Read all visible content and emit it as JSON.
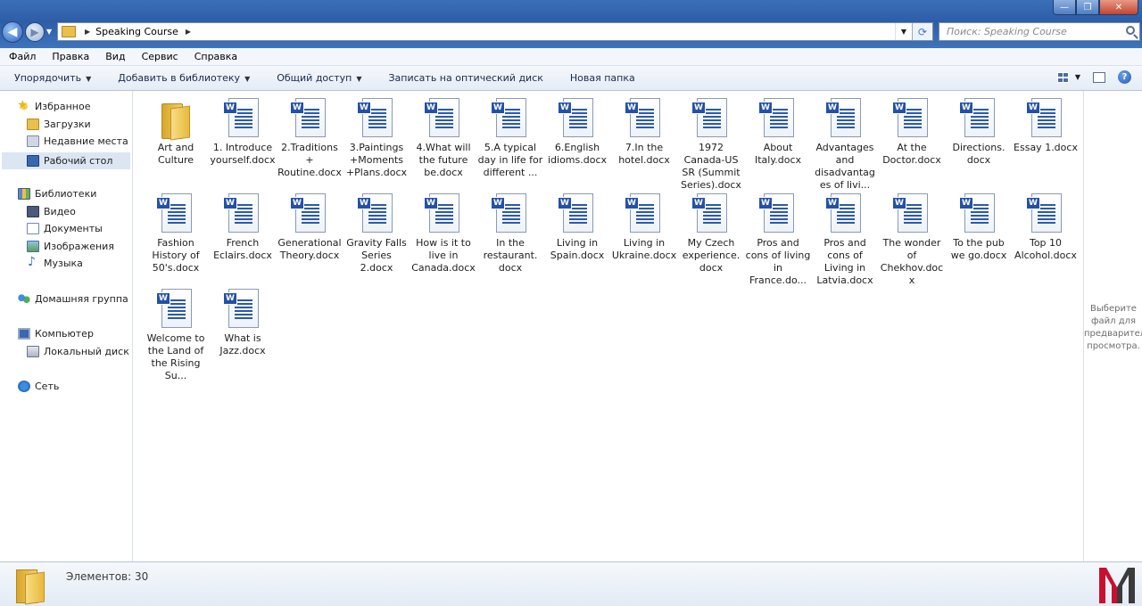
{
  "window": {
    "buttons": {
      "minimize": "—",
      "maximize": "❐",
      "close": "✕"
    }
  },
  "address": {
    "path": "Speaking Course",
    "search_placeholder": "Поиск: Speaking Course"
  },
  "menubar": [
    "Файл",
    "Правка",
    "Вид",
    "Сервис",
    "Справка"
  ],
  "commandbar": {
    "organize": "Упорядочить",
    "add_to_library": "Добавить в библиотеку",
    "share": "Общий доступ",
    "burn": "Записать на оптический диск",
    "new_folder": "Новая папка"
  },
  "navpane": {
    "favorites": "Избранное",
    "downloads": "Загрузки",
    "recent": "Недавние места",
    "desktop": "Рабочий стол",
    "libraries": "Библиотеки",
    "video": "Видео",
    "documents": "Документы",
    "images": "Изображения",
    "music": "Музыка",
    "homegroup": "Домашняя группа",
    "computer": "Компьютер",
    "local_disk": "Локальный диск (C",
    "network": "Сеть"
  },
  "files": [
    {
      "label": "Art and Culture",
      "type": "folder"
    },
    {
      "label": "1. Introduce yourself.docx",
      "type": "docx"
    },
    {
      "label": "2.Traditions + Routine.docx",
      "type": "docx"
    },
    {
      "label": "3.Paintings +Moments +Plans.docx",
      "type": "docx"
    },
    {
      "label": "4.What will the future be.docx",
      "type": "docx"
    },
    {
      "label": "5.A typical day in life for different ...",
      "type": "docx"
    },
    {
      "label": "6.English idioms.docx",
      "type": "docx"
    },
    {
      "label": "7.In the hotel.docx",
      "type": "docx"
    },
    {
      "label": "1972 Canada-US SR (Summit Series).docx",
      "type": "docx"
    },
    {
      "label": "About Italy.docx",
      "type": "docx"
    },
    {
      "label": "Advantages and disadvantages of livi...",
      "type": "docx"
    },
    {
      "label": "At the Doctor.docx",
      "type": "docx"
    },
    {
      "label": "Directions. docx",
      "type": "docx"
    },
    {
      "label": "Essay 1.docx",
      "type": "docx"
    },
    {
      "label": "Fashion History of 50's.docx",
      "type": "docx"
    },
    {
      "label": "French Eclairs.docx",
      "type": "docx"
    },
    {
      "label": "Generational Theory.docx",
      "type": "docx"
    },
    {
      "label": "Gravity Falls Series 2.docx",
      "type": "docx"
    },
    {
      "label": "How is it to live in Canada.docx",
      "type": "docx"
    },
    {
      "label": "In the restaurant. docx",
      "type": "docx"
    },
    {
      "label": "Living in Spain.docx",
      "type": "docx"
    },
    {
      "label": "Living in Ukraine.docx",
      "type": "docx"
    },
    {
      "label": "My Czech experience. docx",
      "type": "docx"
    },
    {
      "label": "Pros and cons of living in France.do...",
      "type": "docx"
    },
    {
      "label": "Pros and cons of Living in Latvia.docx",
      "type": "docx"
    },
    {
      "label": "The wonder of Chekhov.docx",
      "type": "docx"
    },
    {
      "label": "To the pub we go.docx",
      "type": "docx"
    },
    {
      "label": "Top 10 Alcohol.docx",
      "type": "docx"
    },
    {
      "label": "Welcome to the Land of the Rising Su...",
      "type": "docx"
    },
    {
      "label": "What is Jazz.docx",
      "type": "docx"
    }
  ],
  "preview": {
    "message": "Выберите файл для предварительного просмотра."
  },
  "status": {
    "count": "Элементов: 30"
  },
  "colors": {
    "titlebar": "#2d5da6",
    "selection": "#dce6f3",
    "word_blue": "#2451a6",
    "logo_red": "#c8102e",
    "logo_dark": "#3b3b3b"
  }
}
